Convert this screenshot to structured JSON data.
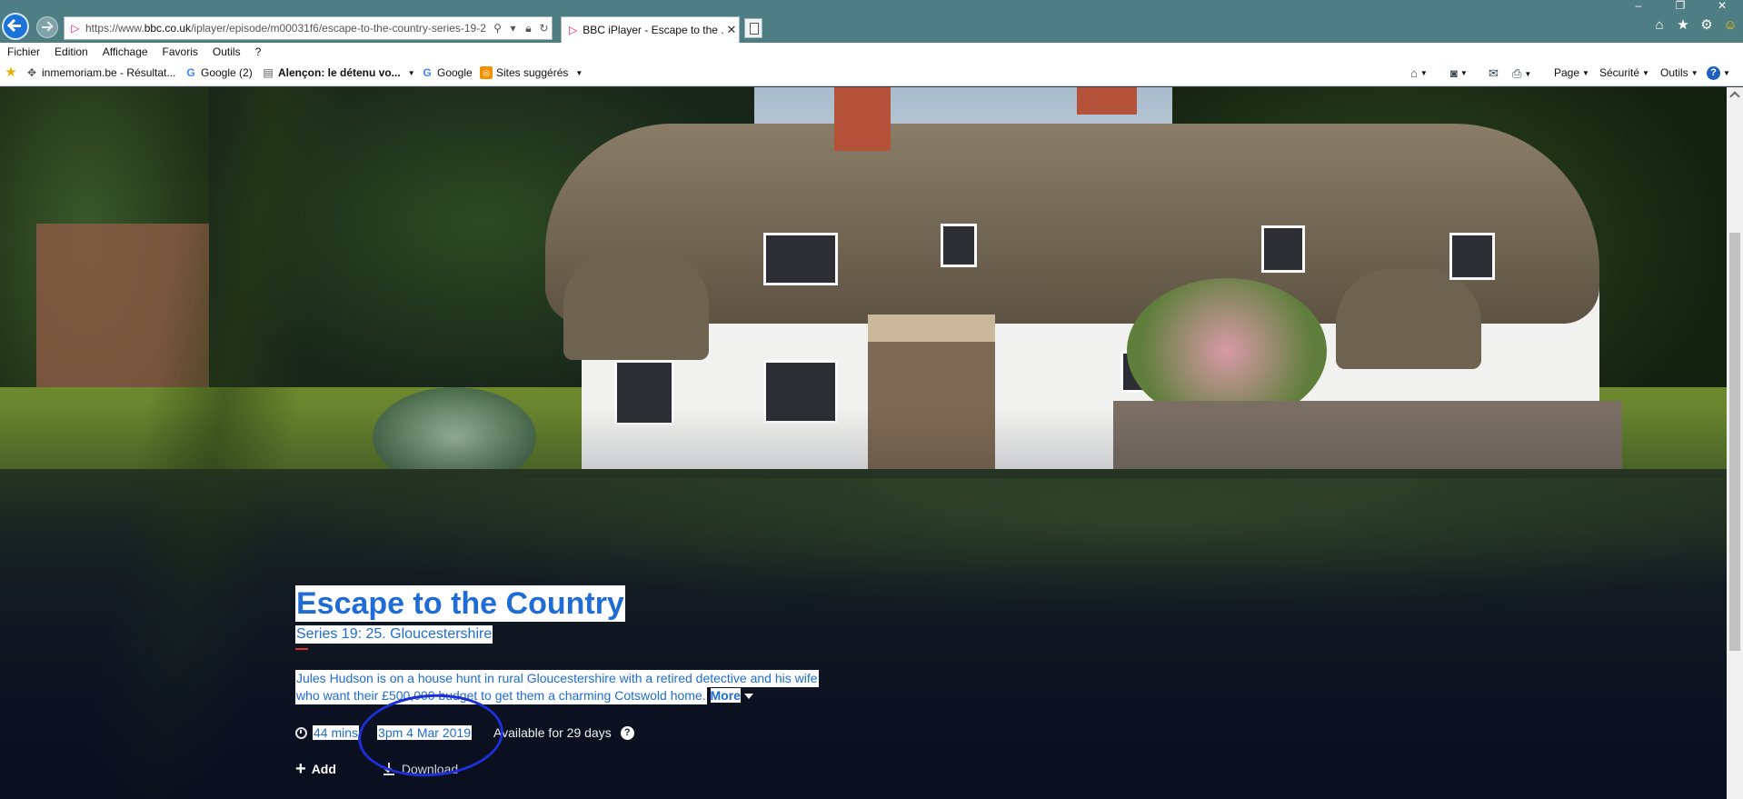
{
  "browser": {
    "url_prefix": "https://www.",
    "url_domain": "bbc.co.uk",
    "url_rest": "/iplayer/episode/m00031f6/escape-to-the-country-series-19-2",
    "tab_title": "BBC iPlayer - Escape to the ...",
    "window_controls": [
      "–",
      "❐",
      "✕"
    ]
  },
  "menu": {
    "items": [
      "Fichier",
      "Edition",
      "Affichage",
      "Favoris",
      "Outils",
      "?"
    ]
  },
  "favorites": {
    "items": [
      "inmemoriam.be - Résultat...",
      "Google (2)",
      "Alençon: le détenu vo...",
      "Google",
      "Sites suggérés"
    ]
  },
  "commandbar": {
    "page": "Page",
    "security": "Sécurité",
    "tools": "Outils"
  },
  "episode": {
    "title": "Escape to the Country",
    "subtitle": "Series 19: 25. Gloucestershire",
    "description_line1": "Jules Hudson is on a house hunt in rural Gloucestershire with a retired detective and his wife",
    "description_line2": "who want their £500,000 budget to get them a charming Cotswold home.",
    "more_label": "More",
    "duration": "44 mins",
    "broadcast": "3pm 4 Mar 2019",
    "availability": "Available for 29 days",
    "help_glyph": "?",
    "add_label": "Add",
    "download_label": "Download"
  },
  "icons": {
    "back": "back-arrow-icon",
    "forward": "forward-arrow-icon",
    "home": "home-icon",
    "favorites": "star-icon",
    "settings": "gear-icon",
    "feedback": "smiley-icon"
  },
  "colors": {
    "titlebar": "#4f7d84",
    "bbc_link_blue": "#1f6cd6",
    "annotation_ink": "#1e2fd8"
  }
}
